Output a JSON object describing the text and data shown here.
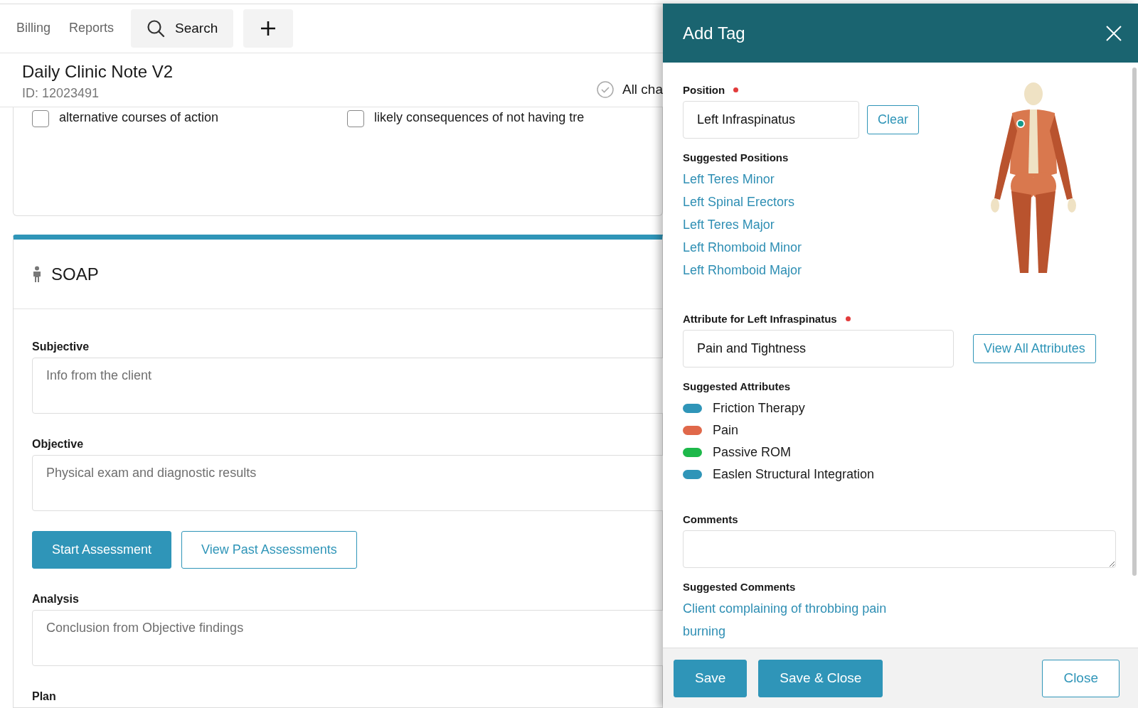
{
  "top_bar": {
    "nav": [
      {
        "label": "Billing"
      },
      {
        "label": "Reports"
      }
    ],
    "search_button": "Search"
  },
  "note": {
    "title": "Daily Clinic Note V2",
    "id": "ID: 12023491",
    "status": "All cha"
  },
  "consent_options": [
    {
      "label": "alternative courses of action",
      "checked": false
    },
    {
      "label": "likely consequences of not having tre",
      "checked": false
    }
  ],
  "soap": {
    "title": "SOAP",
    "sections": [
      {
        "kind": "field",
        "label": "Subjective",
        "placeholder": "Info from the client"
      },
      {
        "kind": "field",
        "label": "Objective",
        "placeholder": "Physical exam and diagnostic results"
      },
      {
        "kind": "actions",
        "buttons": [
          {
            "label": "Start Assessment",
            "primary": true
          },
          {
            "label": "View Past Assessments",
            "primary": false
          }
        ]
      },
      {
        "kind": "field",
        "label": "Analysis",
        "placeholder": "Conclusion from Objective findings"
      },
      {
        "kind": "label",
        "label": "Plan"
      }
    ]
  },
  "panel": {
    "title": "Add Tag",
    "position": {
      "label": "Position",
      "required": true,
      "value": "Left Infraspinatus",
      "button": "Clear"
    },
    "suggested_positions": {
      "title": "Suggested Positions",
      "items": [
        "Left Teres Minor",
        "Left Spinal Erectors",
        "Left Teres Major",
        "Left Rhomboid Minor",
        "Left Rhomboid Major"
      ]
    },
    "attribute": {
      "label": "Attribute for Left Infraspinatus",
      "required": true,
      "value": "Pain and Tightness",
      "button": "View All Attributes"
    },
    "suggested_attributes": {
      "title": "Suggested Attributes",
      "items": [
        {
          "label": "Friction Therapy",
          "color": "#2f95b8"
        },
        {
          "label": "Pain",
          "color": "#e0684a"
        },
        {
          "label": "Passive ROM",
          "color": "#1db84a"
        },
        {
          "label": "Easlen Structural Integration",
          "color": "#2f95b8"
        }
      ]
    },
    "comments": {
      "label": "Comments"
    },
    "suggested_comments": {
      "title": "Suggested Comments",
      "items": [
        "Client complaining of throbbing pain",
        "burning"
      ]
    },
    "footer": {
      "left_buttons": [
        {
          "label": "Save",
          "primary": true
        },
        {
          "label": "Save & Close",
          "primary": true
        }
      ],
      "right_buttons": [
        {
          "label": "Close",
          "primary": false
        }
      ]
    }
  }
}
